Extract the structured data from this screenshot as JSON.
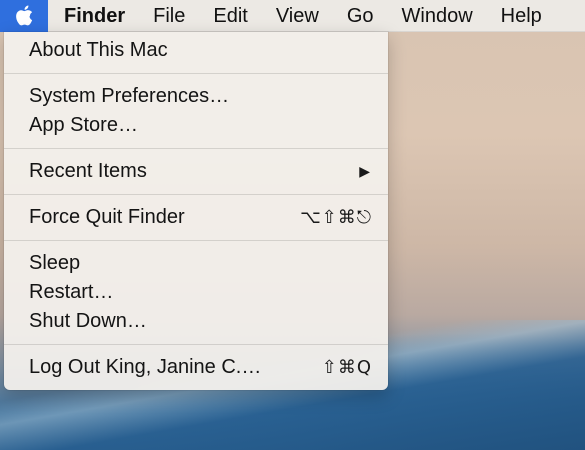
{
  "menubar": {
    "apple_icon": "apple-logo-icon",
    "app_name": "Finder",
    "items": [
      "File",
      "Edit",
      "View",
      "Go",
      "Window",
      "Help"
    ]
  },
  "apple_menu": {
    "about": "About This Mac",
    "system_prefs": "System Preferences…",
    "app_store": "App Store…",
    "recent_items": "Recent Items",
    "recent_items_arrow": "▶",
    "force_quit": "Force Quit Finder",
    "force_quit_shortcut": "⌥⇧⌘⎋",
    "sleep": "Sleep",
    "restart": "Restart…",
    "shut_down": "Shut Down…",
    "log_out": "Log Out King, Janine C.…",
    "log_out_shortcut": "⇧⌘Q"
  },
  "colors": {
    "apple_highlight": "#2f6fde"
  }
}
